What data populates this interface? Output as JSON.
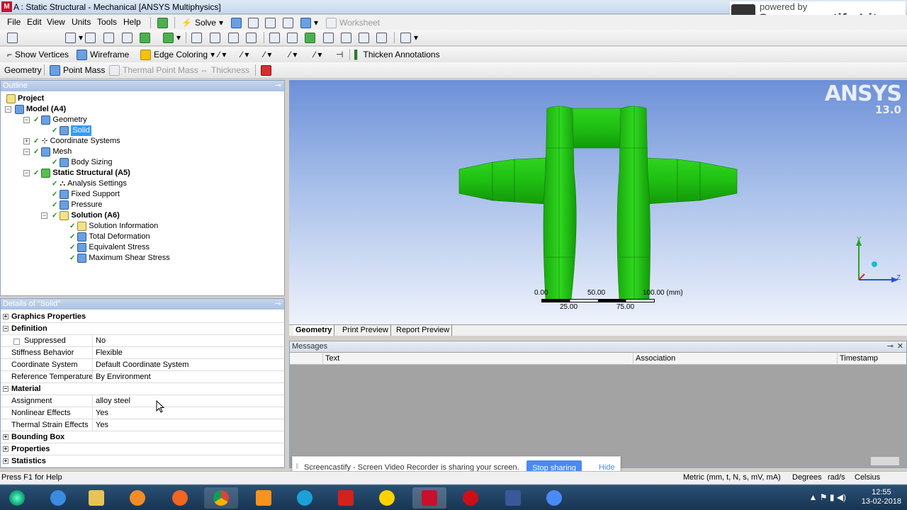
{
  "window": {
    "title": "A : Static Structural - Mechanical [ANSYS Multiphysics]",
    "app_icon": "M"
  },
  "menu": [
    "File",
    "Edit",
    "View",
    "Units",
    "Tools",
    "Help"
  ],
  "toolbar1": {
    "solve": "Solve",
    "worksheet": "Worksheet"
  },
  "toolbar2": {
    "show_vertices": "Show Vertices",
    "wireframe": "Wireframe",
    "edge_coloring": "Edge Coloring",
    "thicken": "Thicken Annotations"
  },
  "toolbar3": {
    "geometry": "Geometry",
    "point_mass": "Point Mass",
    "thermal_point_mass": "Thermal Point Mass",
    "thickness": "Thickness"
  },
  "outline": {
    "title": "Outline",
    "items": [
      {
        "label": "Project"
      },
      {
        "label": "Model (A4)"
      },
      {
        "label": "Geometry"
      },
      {
        "label": "Solid"
      },
      {
        "label": "Coordinate Systems"
      },
      {
        "label": "Mesh"
      },
      {
        "label": "Body Sizing"
      },
      {
        "label": "Static Structural (A5)"
      },
      {
        "label": "Analysis Settings"
      },
      {
        "label": "Fixed Support"
      },
      {
        "label": "Pressure"
      },
      {
        "label": "Solution (A6)"
      },
      {
        "label": "Solution Information"
      },
      {
        "label": "Total Deformation"
      },
      {
        "label": "Equivalent Stress"
      },
      {
        "label": "Maximum Shear Stress"
      }
    ]
  },
  "details": {
    "title": "Details of \"Solid\"",
    "rows": [
      {
        "group": "Graphics Properties"
      },
      {
        "group": "Definition"
      },
      {
        "k": "Suppressed",
        "v": "No"
      },
      {
        "k": "Stiffness Behavior",
        "v": "Flexible"
      },
      {
        "k": "Coordinate System",
        "v": "Default Coordinate System"
      },
      {
        "k": "Reference Temperature",
        "v": "By Environment"
      },
      {
        "group": "Material"
      },
      {
        "k": "Assignment",
        "v": "alloy steel"
      },
      {
        "k": "Nonlinear Effects",
        "v": "Yes"
      },
      {
        "k": "Thermal Strain Effects",
        "v": "Yes"
      },
      {
        "group": "Bounding Box"
      },
      {
        "group": "Properties"
      },
      {
        "group": "Statistics"
      }
    ]
  },
  "viewport": {
    "brand": "ANSYS",
    "version": "13.0",
    "scale": {
      "t0": "0.00",
      "t50": "50.00",
      "t100": "100.00 (mm)",
      "t25": "25.00",
      "t75": "75.00"
    },
    "axes": {
      "y": "Y",
      "z": "Z"
    },
    "model_color": "#22c414"
  },
  "view_tabs": [
    "Geometry",
    "Print Preview",
    "Report Preview"
  ],
  "messages": {
    "title": "Messages",
    "cols": [
      "Text",
      "Association",
      "Timestamp"
    ]
  },
  "screencastify": {
    "text": "Screencastify - Screen Video Recorder is sharing your screen.",
    "stop": "Stop sharing",
    "hide": "Hide",
    "powered": "powered by",
    "brand": "Screencastify Lite"
  },
  "status": {
    "help": "Press F1 for Help",
    "units": "Metric (mm, t, N, s, mV, mA)",
    "degrees": "Degrees",
    "rads": "rad/s",
    "temp": "Celsius"
  },
  "taskbar": {
    "time": "12:55",
    "date": "13-02-2018"
  }
}
